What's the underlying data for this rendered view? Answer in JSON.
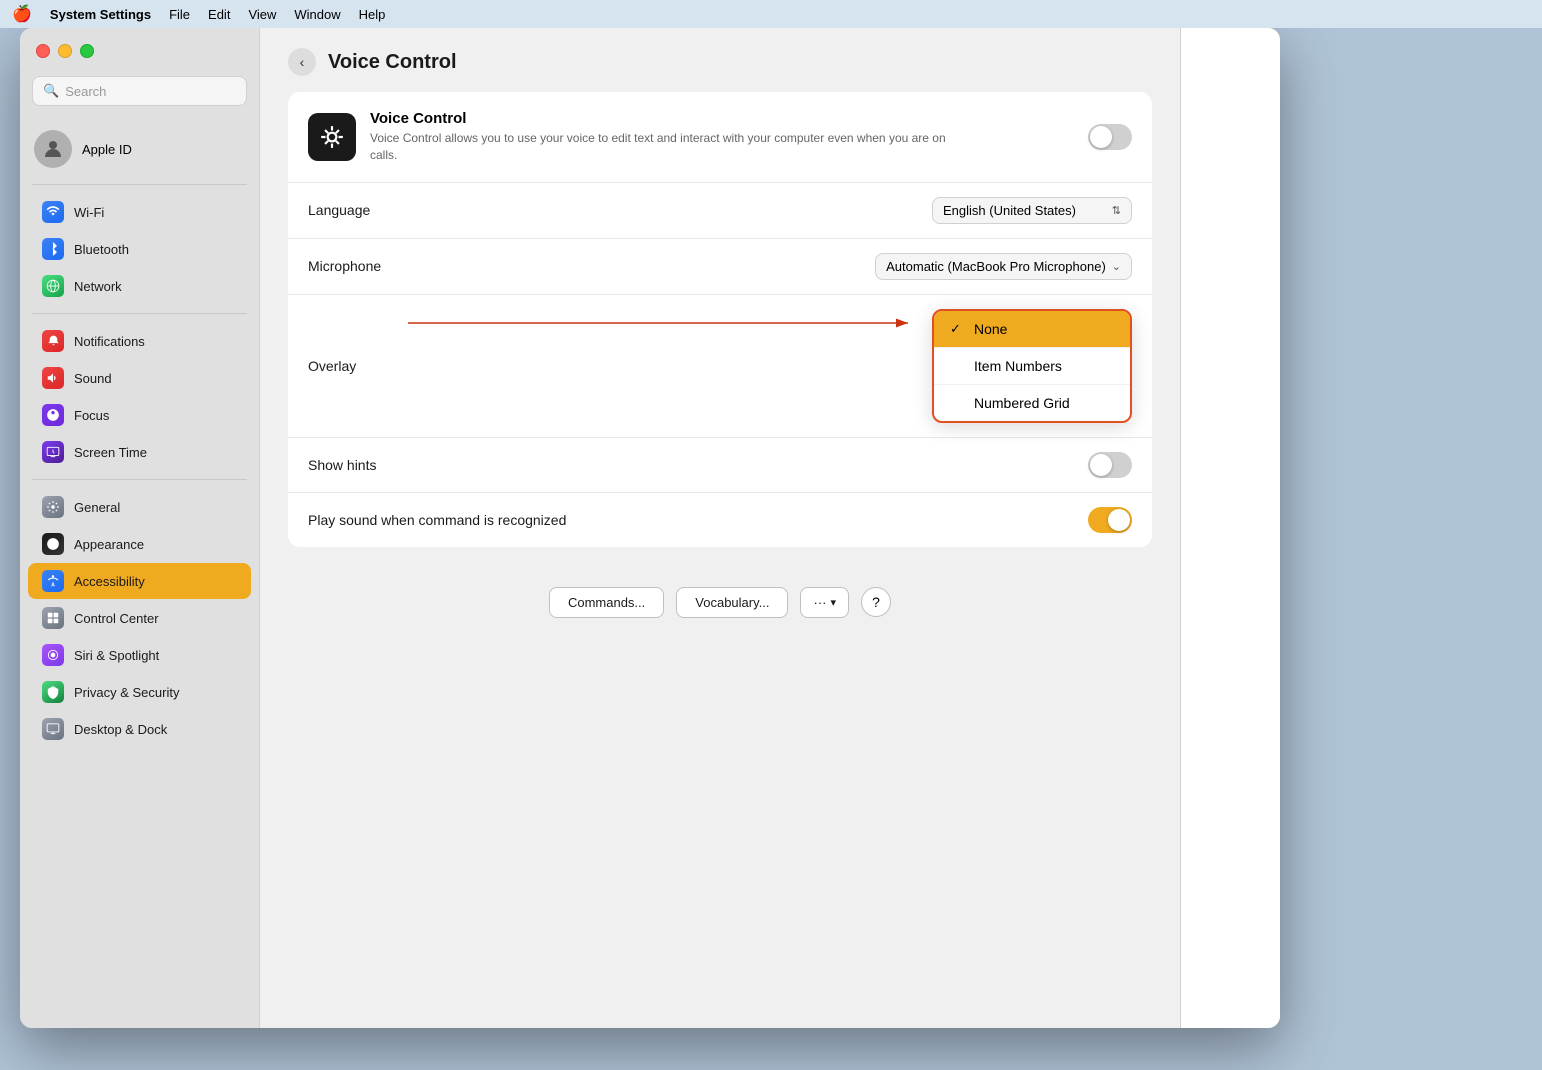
{
  "menubar": {
    "apple": "🍎",
    "app_name": "System Settings",
    "items": [
      "File",
      "Edit",
      "View",
      "Window",
      "Help"
    ]
  },
  "window": {
    "title": "Voice Control"
  },
  "traffic_lights": {
    "close": "close",
    "minimize": "minimize",
    "maximize": "maximize"
  },
  "sidebar": {
    "search_placeholder": "Search",
    "apple_id_label": "Apple ID",
    "items": [
      {
        "id": "wifi",
        "label": "Wi-Fi",
        "icon": "📶",
        "icon_class": "icon-wifi"
      },
      {
        "id": "bluetooth",
        "label": "Bluetooth",
        "icon": "⬡",
        "icon_class": "icon-bluetooth"
      },
      {
        "id": "network",
        "label": "Network",
        "icon": "🌐",
        "icon_class": "icon-network"
      },
      {
        "id": "notifications",
        "label": "Notifications",
        "icon": "🔔",
        "icon_class": "icon-notifications"
      },
      {
        "id": "sound",
        "label": "Sound",
        "icon": "🔊",
        "icon_class": "icon-sound"
      },
      {
        "id": "focus",
        "label": "Focus",
        "icon": "🌙",
        "icon_class": "icon-focus"
      },
      {
        "id": "screentime",
        "label": "Screen Time",
        "icon": "⏱",
        "icon_class": "icon-screentime"
      },
      {
        "id": "general",
        "label": "General",
        "icon": "⚙",
        "icon_class": "icon-general"
      },
      {
        "id": "appearance",
        "label": "Appearance",
        "icon": "●",
        "icon_class": "icon-appearance"
      },
      {
        "id": "accessibility",
        "label": "Accessibility",
        "icon": "♿",
        "icon_class": "icon-accessibility",
        "active": true
      },
      {
        "id": "controlcenter",
        "label": "Control Center",
        "icon": "⊞",
        "icon_class": "icon-controlcenter"
      },
      {
        "id": "siri",
        "label": "Siri & Spotlight",
        "icon": "◎",
        "icon_class": "icon-siri"
      },
      {
        "id": "privacy",
        "label": "Privacy & Security",
        "icon": "✋",
        "icon_class": "icon-privacy"
      },
      {
        "id": "desktop",
        "label": "Desktop & Dock",
        "icon": "□",
        "icon_class": "icon-desktop"
      }
    ]
  },
  "content": {
    "back_button": "‹",
    "page_title": "Voice Control",
    "voice_control": {
      "title": "Voice Control",
      "description": "Voice Control allows you to use your voice to edit text and interact with your computer even when you are on calls.",
      "toggle_on": false
    },
    "rows": [
      {
        "id": "language",
        "label": "Language",
        "value": "English (United States)",
        "type": "stepper"
      },
      {
        "id": "microphone",
        "label": "Microphone",
        "value": "Automatic (MacBook Pro Microphone)",
        "type": "dropdown"
      },
      {
        "id": "overlay",
        "label": "Overlay",
        "type": "dropdown-popup"
      },
      {
        "id": "showhints",
        "label": "Show hints",
        "type": "toggle",
        "toggle_on": false
      },
      {
        "id": "playsound",
        "label": "Play sound when command is recognized",
        "type": "toggle",
        "toggle_on": true
      }
    ],
    "overlay_options": [
      {
        "label": "None",
        "selected": true
      },
      {
        "label": "Item Numbers",
        "selected": false
      },
      {
        "label": "Numbered Grid",
        "selected": false
      }
    ],
    "buttons": {
      "commands": "Commands...",
      "vocabulary": "Vocabulary...",
      "more": "···",
      "help": "?"
    }
  }
}
